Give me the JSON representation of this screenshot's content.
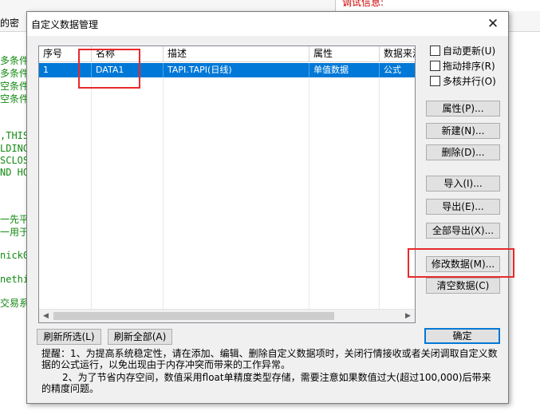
{
  "background": {
    "menu_text": "的密",
    "debug_label": "调试信息:",
    "code_lines": [
      "多条件",
      "多条件",
      "空条件",
      "空条件",
      ",THIS",
      "LDING-",
      "SCLOSE",
      "ND HOL",
      "一先平",
      "一用于",
      "nick0",
      "nethi",
      "交易系"
    ]
  },
  "dialog": {
    "title": "自定义数据管理",
    "close_glyph": "✕",
    "grid": {
      "columns": [
        "序号",
        "名称",
        "描述",
        "属性",
        "数据来源"
      ],
      "rows": [
        {
          "index": "1",
          "name": "DATA1",
          "description": "TAPI.TAPI(日线)",
          "attribute": "单值数据",
          "source": "公式"
        }
      ],
      "scroll_left": "◀",
      "scroll_right": "▶"
    },
    "options": {
      "auto_update": "自动更新(U)",
      "drag_sort": "拖动排序(R)",
      "multi_core": "多核并行(O)"
    },
    "buttons": {
      "properties": "属性(P)...",
      "new": "新建(N)...",
      "delete": "删除(D)...",
      "import": "导入(I)...",
      "export": "导出(E)...",
      "export_all": "全部导出(X)...",
      "modify": "修改数据(M)...",
      "clear": "清空数据(C)",
      "refresh_selected": "刷新所选(L)",
      "refresh_all": "刷新全部(A)",
      "ok": "确定"
    },
    "notes": {
      "line1": "提醒：1、为提高系统稳定性，请在添加、编辑、删除自定义数据项时，关闭行情接收或者关闭调取自定义数据的公式运行，以免出现由于内存冲突而带来的工作异常。",
      "line2": "2、为了节省内存空间，数值采用float单精度类型存储，需要注意如果数值过大(超过100,000)后带来的精度问题。"
    }
  },
  "colors": {
    "selection": "#0078d7",
    "annotation": "#e8292b",
    "code_text": "#138a13"
  }
}
